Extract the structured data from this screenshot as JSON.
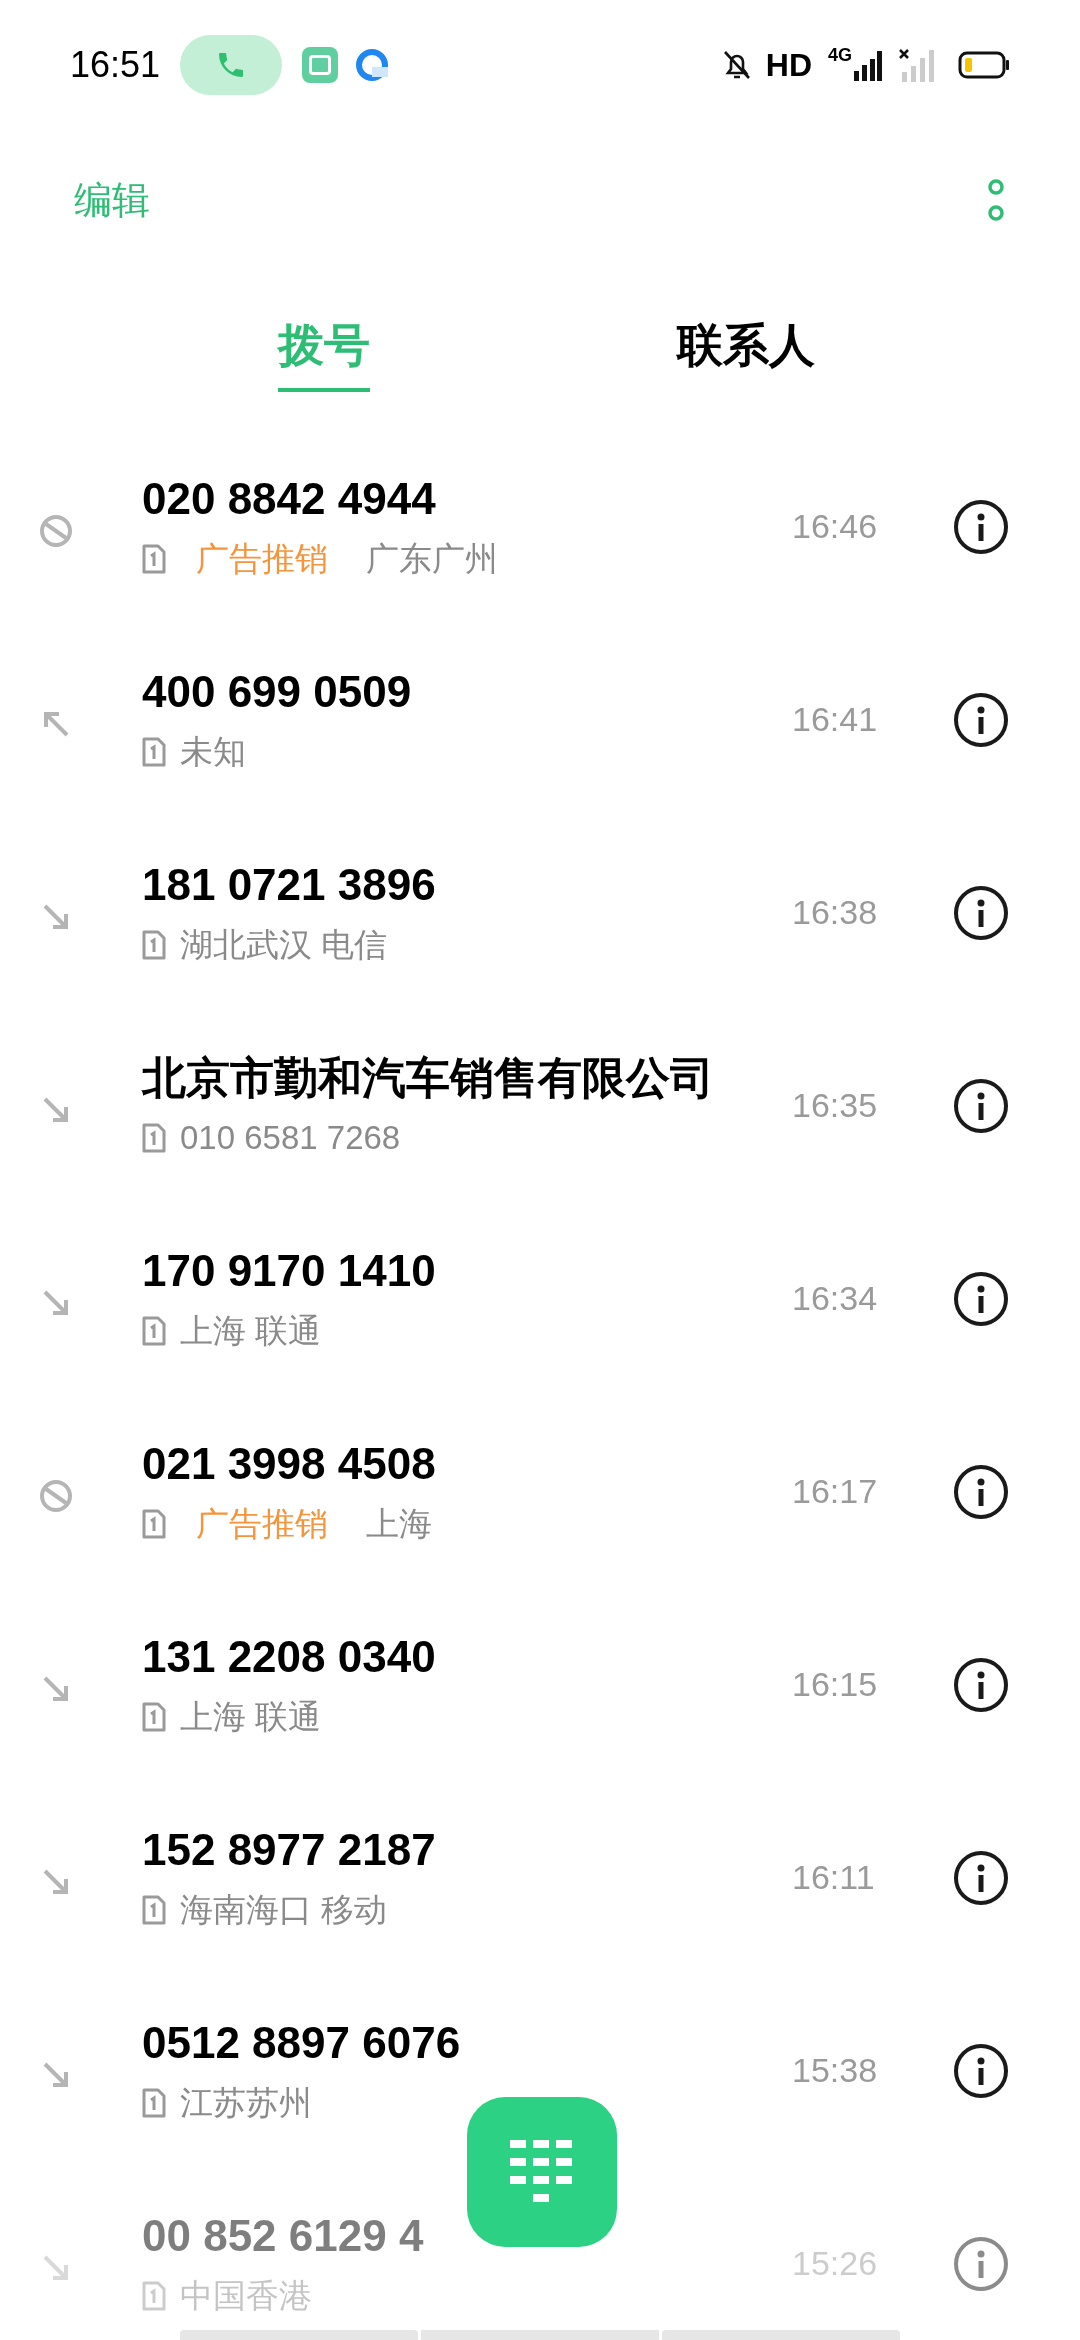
{
  "status_bar": {
    "time": "16:51",
    "hd": "HD",
    "network": "4G"
  },
  "header": {
    "edit": "编辑"
  },
  "tabs": [
    {
      "label": "拨号",
      "selected": true
    },
    {
      "label": "联系人",
      "selected": false
    }
  ],
  "calls": [
    {
      "kind": "blocked",
      "title": "020 8842 4944",
      "tag": "广告推销",
      "detail": "广东广州",
      "time": "16:46",
      "dimmed": false
    },
    {
      "kind": "outgoing",
      "title": "400 699 0509",
      "detail": "未知",
      "time": "16:41",
      "dimmed": false
    },
    {
      "kind": "incoming",
      "title": "181 0721 3896",
      "detail": "湖北武汉 电信",
      "time": "16:38",
      "dimmed": false
    },
    {
      "kind": "incoming",
      "title": "北京市勤和汽车销售有限公司",
      "detail": "010 6581 7268",
      "time": "16:35",
      "dimmed": false
    },
    {
      "kind": "incoming",
      "title": "170 9170 1410",
      "detail": "上海 联通",
      "time": "16:34",
      "dimmed": false
    },
    {
      "kind": "blocked",
      "title": "021 3998 4508",
      "tag": "广告推销",
      "detail": "上海",
      "time": "16:17",
      "dimmed": false
    },
    {
      "kind": "incoming",
      "title": "131 2208 0340",
      "detail": "上海 联通",
      "time": "16:15",
      "dimmed": false
    },
    {
      "kind": "incoming",
      "title": "152 8977 2187",
      "detail": "海南海口 移动",
      "time": "16:11",
      "dimmed": false
    },
    {
      "kind": "incoming",
      "title": "0512 8897 6076",
      "detail": "江苏苏州",
      "time": "15:38",
      "dimmed": false
    },
    {
      "kind": "incoming",
      "title": "00 852 6129 4",
      "detail": "中国香港",
      "time": "15:26",
      "dimmed": true
    }
  ]
}
